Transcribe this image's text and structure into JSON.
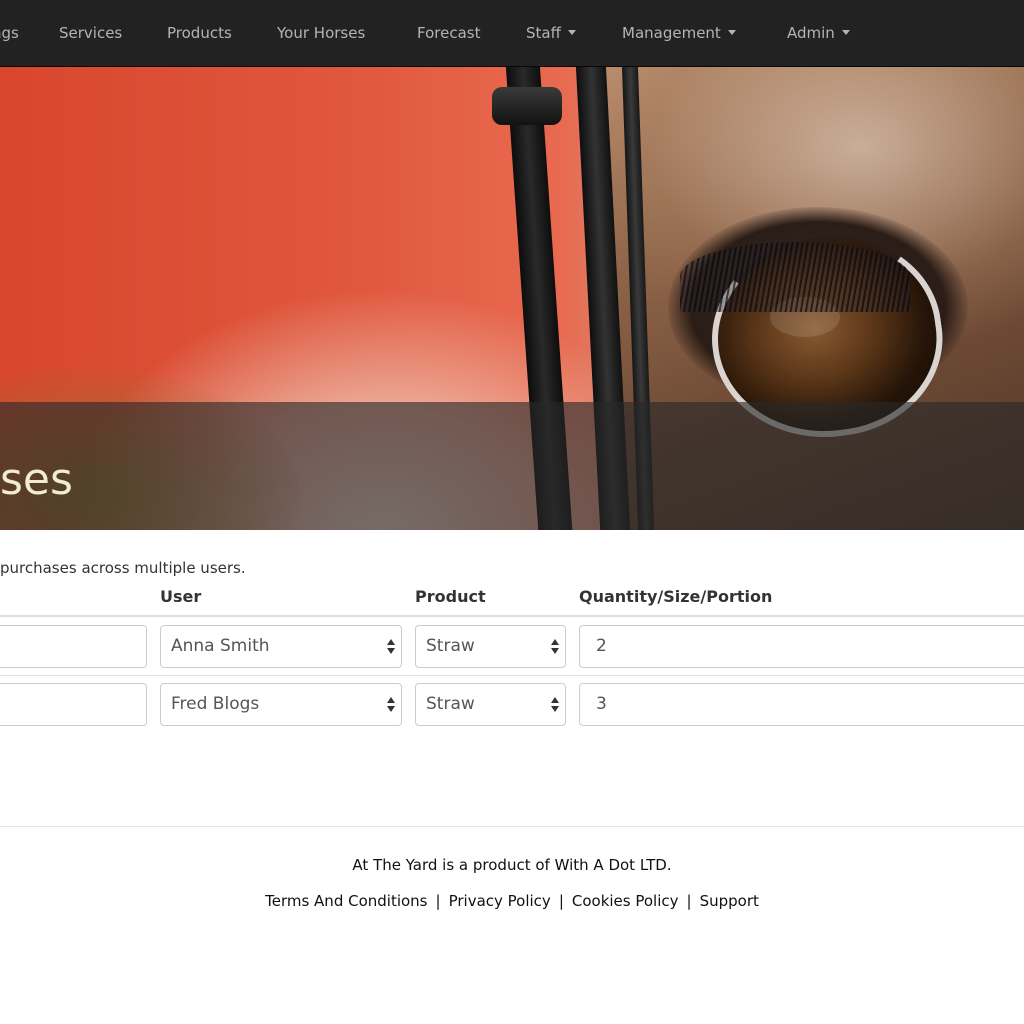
{
  "navbar": {
    "items": [
      {
        "label": "ngs",
        "dropdown": false
      },
      {
        "label": "Services",
        "dropdown": false
      },
      {
        "label": "Products",
        "dropdown": false
      },
      {
        "label": "Your Horses",
        "dropdown": false
      },
      {
        "label": "Forecast",
        "dropdown": false
      },
      {
        "label": "Staff",
        "dropdown": true
      },
      {
        "label": "Management",
        "dropdown": true
      },
      {
        "label": "Admin",
        "dropdown": true
      }
    ],
    "background": "#222222",
    "text_color": "#b4b4b4"
  },
  "hero": {
    "title": "ses",
    "title_color": "#f2ecd2"
  },
  "content": {
    "intro": "purchases across multiple users.",
    "table": {
      "headers": {
        "user": "User",
        "product": "Product",
        "quantity": "Quantity/Size/Portion"
      },
      "rows": [
        {
          "first": "",
          "user": "Anna Smith",
          "product": "Straw",
          "quantity": "2"
        },
        {
          "first": "",
          "user": "Fred Blogs",
          "product": "Straw",
          "quantity": "3"
        }
      ]
    }
  },
  "footer": {
    "copy": "At The Yard is a product of With A Dot LTD.",
    "links": [
      "Terms And Conditions",
      "Privacy Policy",
      "Cookies Policy",
      "Support"
    ],
    "separator": "|"
  }
}
